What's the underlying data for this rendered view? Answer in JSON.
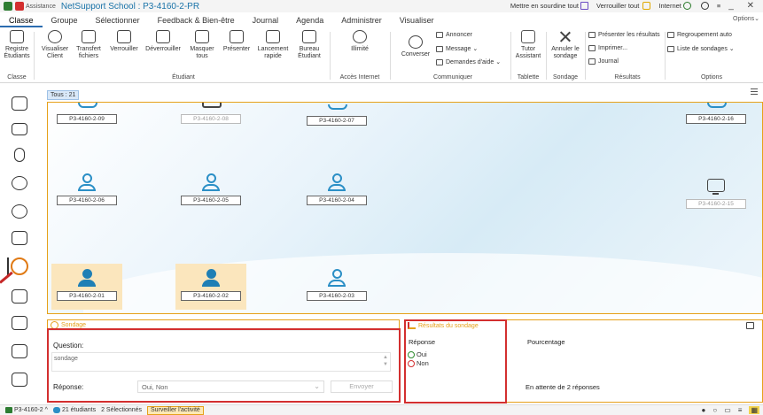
{
  "titlebar": {
    "assistance_label": "Assistance",
    "title": "NetSupport School : P3-4160-2-PR",
    "mute_all": "Mettre en sourdine tout",
    "lock_all": "Verrouiller tout",
    "internet": "Internet"
  },
  "menu": {
    "tabs": [
      "Classe",
      "Groupe",
      "Sélectionner",
      "Feedback & Bien-être",
      "Journal",
      "Agenda",
      "Administrer",
      "Visualiser"
    ],
    "active": "Classe",
    "options": "Options"
  },
  "ribbon": {
    "buttons": {
      "registre": "Registre\nÉtudiants",
      "visualiser": "Visualiser\nClient",
      "transfert": "Transfert\nfichiers",
      "verrouiller": "Verrouiller",
      "deverrouiller": "Déverrouiller",
      "masquer": "Masquer\ntous",
      "presenter": "Présenter",
      "lancement": "Lancement\nrapide",
      "bureau": "Bureau\nÉtudiant",
      "illimite": "Illimité",
      "converser": "Converser",
      "tutor": "Tutor\nAssistant",
      "annuler": "Annuler le\nsondage"
    },
    "communicate_items": [
      "Annoncer",
      "Message",
      "Demandes d'aide"
    ],
    "results_items": [
      "Présenter les résultats",
      "Imprimer...",
      "Journal"
    ],
    "options_items": [
      "Regroupement auto",
      "Liste de sondages"
    ],
    "groups": {
      "classe": "Classe",
      "etudiant": "Étudiant",
      "acces": "Accès Internet",
      "communiquer": "Communiquer",
      "tablette": "Tablette",
      "sondage": "Sondage",
      "resultats": "Résultats",
      "options": "Options"
    }
  },
  "main": {
    "tab_all": "Tous : 21",
    "students": [
      {
        "label": "P3-4160-2-09",
        "kind": "partial"
      },
      {
        "label": "P3-4160-2-08",
        "kind": "partial-monitor",
        "dim": true
      },
      {
        "label": "P3-4160-2-07",
        "kind": "partial"
      },
      {
        "label": "P3-4160-2-16",
        "kind": "partial"
      },
      {
        "label": "P3-4160-2-06",
        "kind": "student"
      },
      {
        "label": "P3-4160-2-05",
        "kind": "student"
      },
      {
        "label": "P3-4160-2-04",
        "kind": "student"
      },
      {
        "label": "P3-4160-2-15",
        "kind": "monitor",
        "dim": true
      },
      {
        "label": "P3-4160-2-01",
        "kind": "student-filled",
        "selected": true
      },
      {
        "label": "P3-4160-2-02",
        "kind": "student-filled",
        "selected": true
      },
      {
        "label": "P3-4160-2-03",
        "kind": "student"
      }
    ]
  },
  "poll": {
    "title": "Sondage",
    "question_label": "Question:",
    "question_placeholder": "sondage",
    "response_label": "Réponse:",
    "response_value": "Oui, Non",
    "send_label": "Envoyer"
  },
  "results": {
    "title": "Résultats du sondage",
    "col_response": "Réponse",
    "col_percentage": "Pourcentage",
    "options": [
      "Oui",
      "Non"
    ],
    "waiting": "En attente de 2 réponses"
  },
  "statusbar": {
    "machine": "P3-4160-2",
    "students": "21 étudiants",
    "selected": "2 Sélectionnés",
    "monitor": "Surveiller l'activité"
  },
  "colors": {
    "accent": "#e6a11a",
    "highlight_red": "#d32f2f",
    "student_blue": "#2b8fc6",
    "title_blue": "#1a73a8"
  }
}
